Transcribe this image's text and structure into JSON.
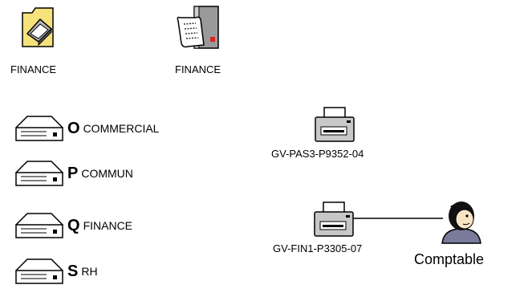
{
  "top_items": [
    {
      "label": "FINANCE",
      "icon": "scanner-folder-icon"
    },
    {
      "label": "FINANCE",
      "icon": "print-server-icon"
    }
  ],
  "drives": [
    {
      "letter": "O",
      "name": "COMMERCIAL",
      "icon": "network-drive-icon"
    },
    {
      "letter": "P",
      "name": "COMMUN",
      "icon": "network-drive-icon"
    },
    {
      "letter": "Q",
      "name": "FINANCE",
      "icon": "network-drive-icon"
    },
    {
      "letter": "S",
      "name": "RH",
      "icon": "network-drive-icon"
    }
  ],
  "printers": [
    {
      "label": "GV-PAS3-P9352-04",
      "icon": "printer-icon"
    },
    {
      "label": "GV-FIN1-P3305-07",
      "icon": "printer-icon"
    }
  ],
  "user": {
    "label": "Comptable",
    "icon": "user-icon"
  },
  "colors": {
    "folder": "#f5e27a",
    "outline": "#000000",
    "server": "#9a9a9a",
    "skin": "#fbe4c4"
  }
}
